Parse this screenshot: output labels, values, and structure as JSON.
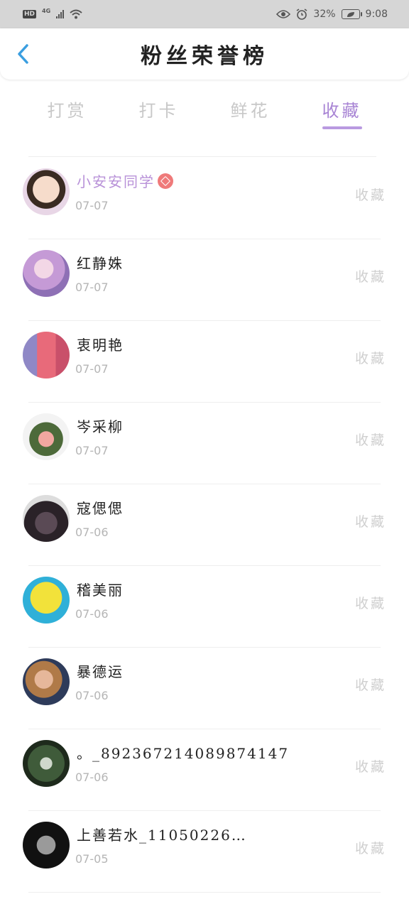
{
  "status_bar": {
    "hd": "HD",
    "network": "4G",
    "battery_pct": "32%",
    "time": "9:08"
  },
  "header": {
    "title": "粉丝荣誉榜"
  },
  "tabs": [
    {
      "label": "打赏",
      "active": false
    },
    {
      "label": "打卡",
      "active": false
    },
    {
      "label": "鲜花",
      "active": false
    },
    {
      "label": "收藏",
      "active": true
    }
  ],
  "fans": [
    {
      "name": "小安安同学",
      "date": "07-07",
      "action": "收藏",
      "vip": true
    },
    {
      "name": "红静姝",
      "date": "07-07",
      "action": "收藏",
      "vip": false
    },
    {
      "name": "衷明艳",
      "date": "07-07",
      "action": "收藏",
      "vip": false
    },
    {
      "name": "岑采柳",
      "date": "07-07",
      "action": "收藏",
      "vip": false
    },
    {
      "name": "寇偲偲",
      "date": "07-06",
      "action": "收藏",
      "vip": false
    },
    {
      "name": "稽美丽",
      "date": "07-06",
      "action": "收藏",
      "vip": false
    },
    {
      "name": "暴德运",
      "date": "07-06",
      "action": "收藏",
      "vip": false
    },
    {
      "name": "。_892367214089874147",
      "date": "07-06",
      "action": "收藏",
      "vip": false
    },
    {
      "name": "上善若水_11050226…",
      "date": "07-05",
      "action": "收藏",
      "vip": false
    }
  ],
  "colors": {
    "accent": "#a884d4",
    "back_arrow": "#3a9ee0",
    "vip_badge": "#ef7a7a"
  }
}
